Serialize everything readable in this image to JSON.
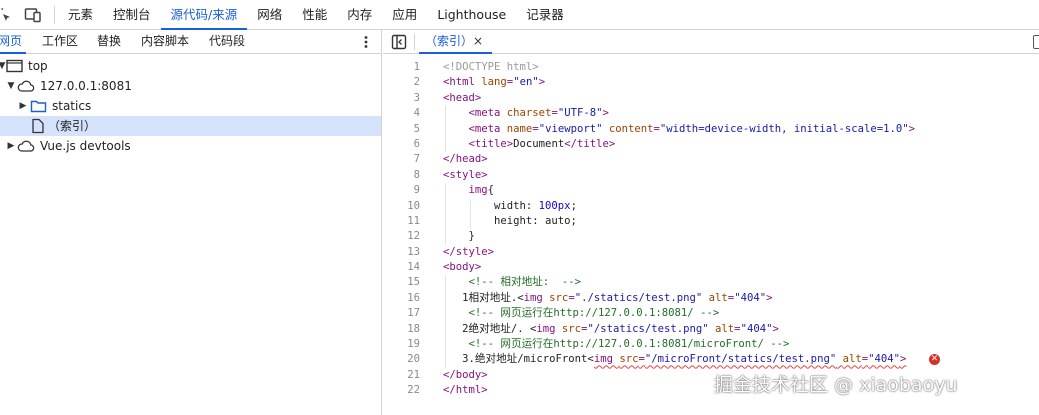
{
  "toolbar": {
    "tabs": [
      {
        "label": "元素"
      },
      {
        "label": "控制台"
      },
      {
        "label": "源代码/来源"
      },
      {
        "label": "网络"
      },
      {
        "label": "性能"
      },
      {
        "label": "内存"
      },
      {
        "label": "应用"
      },
      {
        "label": "Lighthouse"
      },
      {
        "label": "记录器"
      }
    ],
    "active_index": 2
  },
  "navigator": {
    "tabs": [
      {
        "label": "网页"
      },
      {
        "label": "工作区"
      },
      {
        "label": "替换"
      },
      {
        "label": "内容脚本"
      },
      {
        "label": "代码段"
      }
    ],
    "tree": [
      {
        "label": "top",
        "icon": "frame-icon",
        "expanded": true
      },
      {
        "label": "127.0.0.1:8081",
        "icon": "cloud-icon",
        "expanded": true
      },
      {
        "label": "statics",
        "icon": "folder-icon",
        "expanded": false
      },
      {
        "label": "（索引）",
        "icon": "file-icon",
        "selected": true
      },
      {
        "label": "Vue.js devtools",
        "icon": "cloud-icon",
        "expanded": false
      }
    ]
  },
  "editor": {
    "file_tab_label": "（索引）",
    "close_glyph": "×",
    "error_glyph": "✕",
    "line_numbers": [
      "1",
      "2",
      "3",
      "4",
      "5",
      "6",
      "7",
      "8",
      "9",
      "10",
      "11",
      "12",
      "13",
      "14",
      "15",
      "16",
      "17",
      "18",
      "19",
      "20",
      "21",
      "22"
    ],
    "lines": [
      [
        {
          "c": "dt",
          "t": "<!DOCTYPE html>"
        }
      ],
      [
        {
          "c": "tg",
          "t": "<html "
        },
        {
          "c": "at",
          "t": "lang"
        },
        {
          "c": "tg",
          "t": "="
        },
        {
          "c": "av",
          "t": "\"en\""
        },
        {
          "c": "tg",
          "t": ">"
        }
      ],
      [
        {
          "c": "tg",
          "t": "<head>"
        }
      ],
      [
        {
          "c": "pl",
          "t": "    "
        },
        {
          "c": "tg",
          "t": "<meta "
        },
        {
          "c": "at",
          "t": "charset"
        },
        {
          "c": "tg",
          "t": "="
        },
        {
          "c": "av",
          "t": "\"UTF-8\""
        },
        {
          "c": "tg",
          "t": ">"
        }
      ],
      [
        {
          "c": "pl",
          "t": "    "
        },
        {
          "c": "tg",
          "t": "<meta "
        },
        {
          "c": "at",
          "t": "name"
        },
        {
          "c": "tg",
          "t": "="
        },
        {
          "c": "av",
          "t": "\"viewport\""
        },
        {
          "c": "pl",
          "t": " "
        },
        {
          "c": "at",
          "t": "content"
        },
        {
          "c": "tg",
          "t": "="
        },
        {
          "c": "av",
          "t": "\"width=device-width, initial-scale=1.0\""
        },
        {
          "c": "tg",
          "t": ">"
        }
      ],
      [
        {
          "c": "pl",
          "t": "    "
        },
        {
          "c": "tg",
          "t": "<title>"
        },
        {
          "c": "pl",
          "t": "Document"
        },
        {
          "c": "tg",
          "t": "</title>"
        }
      ],
      [
        {
          "c": "tg",
          "t": "</head>"
        }
      ],
      [
        {
          "c": "tg",
          "t": "<style>"
        }
      ],
      [
        {
          "c": "pl",
          "t": "    "
        },
        {
          "c": "tg",
          "t": "img"
        },
        {
          "c": "pl",
          "t": "{"
        }
      ],
      [
        {
          "c": "pl",
          "t": "        width: "
        },
        {
          "c": "nm",
          "t": "100px"
        },
        {
          "c": "pl",
          "t": ";"
        }
      ],
      [
        {
          "c": "pl",
          "t": "        height: auto;"
        }
      ],
      [
        {
          "c": "pl",
          "t": "    }"
        }
      ],
      [
        {
          "c": "tg",
          "t": "</style>"
        }
      ],
      [
        {
          "c": "tg",
          "t": "<body>"
        }
      ],
      [
        {
          "c": "pl",
          "t": "    "
        },
        {
          "c": "cm",
          "t": "<!-- 相对地址:  -->"
        }
      ],
      [
        {
          "c": "pl",
          "t": "   1相对地址.<"
        },
        {
          "c": "tg",
          "t": "img "
        },
        {
          "c": "at",
          "t": "src"
        },
        {
          "c": "tg",
          "t": "="
        },
        {
          "c": "av",
          "t": "\"./statics/test.png\""
        },
        {
          "c": "pl",
          "t": " "
        },
        {
          "c": "at",
          "t": "alt"
        },
        {
          "c": "tg",
          "t": "="
        },
        {
          "c": "av",
          "t": "\"404\""
        },
        {
          "c": "tg",
          "t": ">"
        }
      ],
      [
        {
          "c": "pl",
          "t": "    "
        },
        {
          "c": "cm",
          "t": "<!-- 网页运行在http://127.0.0.1:8081/ -->"
        }
      ],
      [
        {
          "c": "pl",
          "t": "   2绝对地址/. <"
        },
        {
          "c": "tg",
          "t": "img "
        },
        {
          "c": "at",
          "t": "src"
        },
        {
          "c": "tg",
          "t": "="
        },
        {
          "c": "av",
          "t": "\"/statics/test.png\""
        },
        {
          "c": "pl",
          "t": " "
        },
        {
          "c": "at",
          "t": "alt"
        },
        {
          "c": "tg",
          "t": "="
        },
        {
          "c": "av",
          "t": "\"404\""
        },
        {
          "c": "tg",
          "t": ">"
        }
      ],
      [
        {
          "c": "pl",
          "t": "    "
        },
        {
          "c": "cm",
          "t": "<!-- 网页运行在http://127.0.0.1:8081/microFront/ -->"
        }
      ],
      [
        {
          "c": "pl",
          "t": "   3.绝对地址/microFront<"
        },
        {
          "c": "tg",
          "t": "img "
        },
        {
          "c": "at",
          "t": "src"
        },
        {
          "c": "tg",
          "t": "="
        },
        {
          "c": "av",
          "t": "\"/microFront/statics/test.png\""
        },
        {
          "c": "pl",
          "t": " "
        },
        {
          "c": "at",
          "t": "alt"
        },
        {
          "c": "tg",
          "t": "="
        },
        {
          "c": "av",
          "t": "\"404\""
        },
        {
          "c": "tg",
          "t": ">"
        }
      ],
      [
        {
          "c": "tg",
          "t": "</body>"
        }
      ],
      [
        {
          "c": "tg",
          "t": "</html>"
        }
      ]
    ],
    "error_line_index": 19
  },
  "watermark": "掘金技术社区 @ xiaobaoyu",
  "colors": {
    "accent": "#1a5fd6",
    "selection": "#d4e3fb",
    "error": "#d93025"
  }
}
